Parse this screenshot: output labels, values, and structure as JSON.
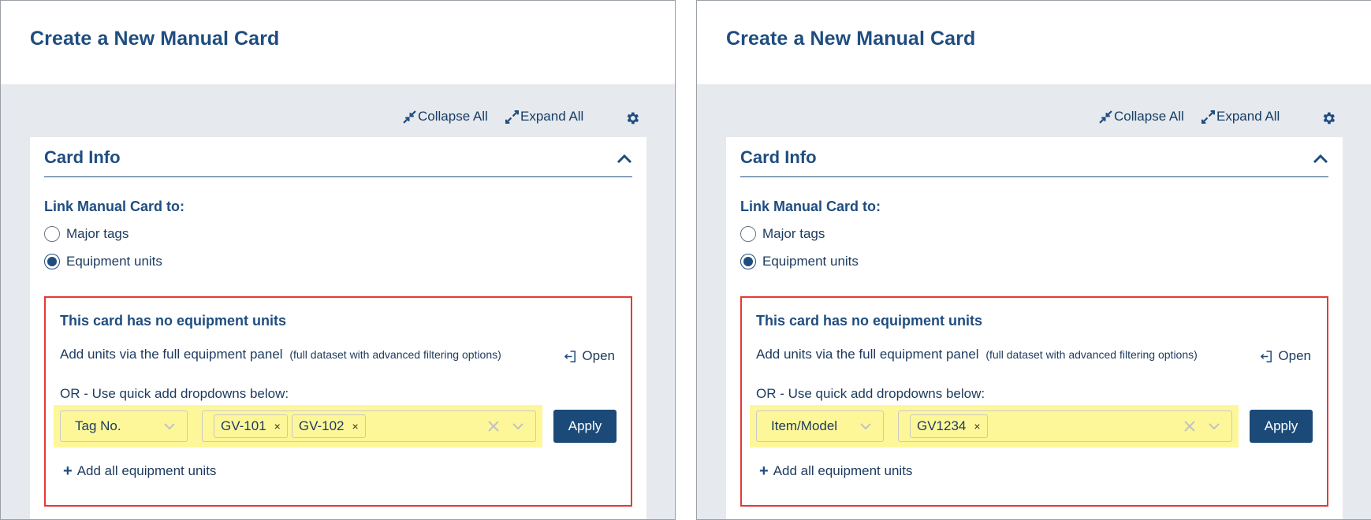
{
  "panels": [
    {
      "title": "Create a New Manual Card",
      "toolbar": {
        "collapse_all": "Collapse All",
        "expand_all": "Expand All"
      },
      "card": {
        "title": "Card Info",
        "link_label": "Link Manual Card to:",
        "radios": [
          {
            "label": "Major tags",
            "checked": false
          },
          {
            "label": "Equipment units",
            "checked": true
          }
        ],
        "equipment": {
          "no_units": "This card has no equipment units",
          "add_via": "Add units via the full equipment panel",
          "add_via_note": "(full dataset with advanced filtering options)",
          "open": "Open",
          "or_text": "OR - Use quick add dropdowns below:",
          "type_select": "Tag No.",
          "chips": [
            "GV-101",
            "GV-102"
          ],
          "apply": "Apply",
          "add_all": "Add all equipment units"
        }
      }
    },
    {
      "title": "Create a New Manual Card",
      "toolbar": {
        "collapse_all": "Collapse All",
        "expand_all": "Expand All"
      },
      "card": {
        "title": "Card Info",
        "link_label": "Link Manual Card to:",
        "radios": [
          {
            "label": "Major tags",
            "checked": false
          },
          {
            "label": "Equipment units",
            "checked": true
          }
        ],
        "equipment": {
          "no_units": "This card has no equipment units",
          "add_via": "Add units via the full equipment panel",
          "add_via_note": "(full dataset with advanced filtering options)",
          "open": "Open",
          "or_text": "OR - Use quick add dropdowns below:",
          "type_select": "Item/Model",
          "chips": [
            "GV1234"
          ],
          "apply": "Apply",
          "add_all": "Add all equipment units"
        }
      }
    }
  ],
  "icons": {
    "collapse": "collapse-arrows-icon",
    "expand": "expand-arrows-icon",
    "settings": "gear-icon",
    "chevron_up": "chevron-up-icon",
    "chevron_down": "chevron-down-icon",
    "clear": "close-icon",
    "open": "open-panel-icon",
    "plus": "plus-icon"
  },
  "colors": {
    "primary": "#1f4d80",
    "button": "#1b4a78",
    "highlight": "#fdf79a",
    "alert_border": "#e53935",
    "background": "#e6e9ed"
  }
}
